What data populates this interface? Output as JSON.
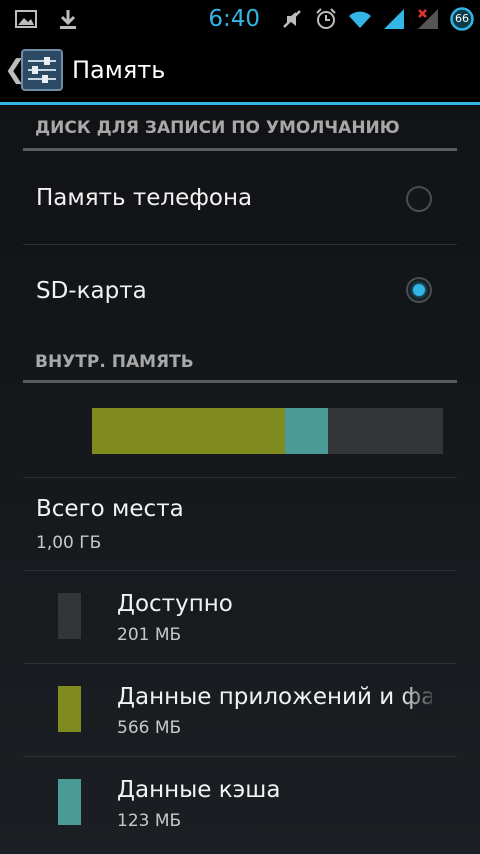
{
  "status_bar": {
    "time": "6:40",
    "battery_level": "66",
    "colors": {
      "accent": "#33b5e5",
      "icon": "#bdbdbd"
    },
    "icons": [
      "image-icon",
      "download-icon",
      "mute-icon",
      "alarm-icon",
      "wifi-icon",
      "signal-icon",
      "no-signal-icon",
      "battery-icon"
    ]
  },
  "action_bar": {
    "title": "Память",
    "up_caret": "❮",
    "icon": "settings-sliders-icon"
  },
  "sections": {
    "default_disk_header": "ДИСК ДЛЯ ЗАПИСИ ПО УМОЛЧАНИЮ",
    "internal_memory_header": "ВНУТР. ПАМЯТЬ"
  },
  "radio_options": [
    {
      "label": "Память телефона",
      "checked": false
    },
    {
      "label": "SD-карта",
      "checked": true
    }
  ],
  "usage": {
    "segments": [
      {
        "name": "apps",
        "fraction": 0.551,
        "color": "#7f8a1f"
      },
      {
        "name": "cache",
        "fraction": 0.12,
        "color": "#4a9a96"
      },
      {
        "name": "available",
        "fraction": 0.329,
        "color": "#333536"
      }
    ]
  },
  "total": {
    "title": "Всего места",
    "value": "1,00 ГБ"
  },
  "legend": [
    {
      "title": "Доступно",
      "value": "201 МБ",
      "color": "#333536"
    },
    {
      "title": "Данные приложений и фа",
      "value": "566 МБ",
      "color": "#7f8a1f"
    },
    {
      "title": "Данные кэша",
      "value": "123 МБ",
      "color": "#4a9a96"
    }
  ]
}
